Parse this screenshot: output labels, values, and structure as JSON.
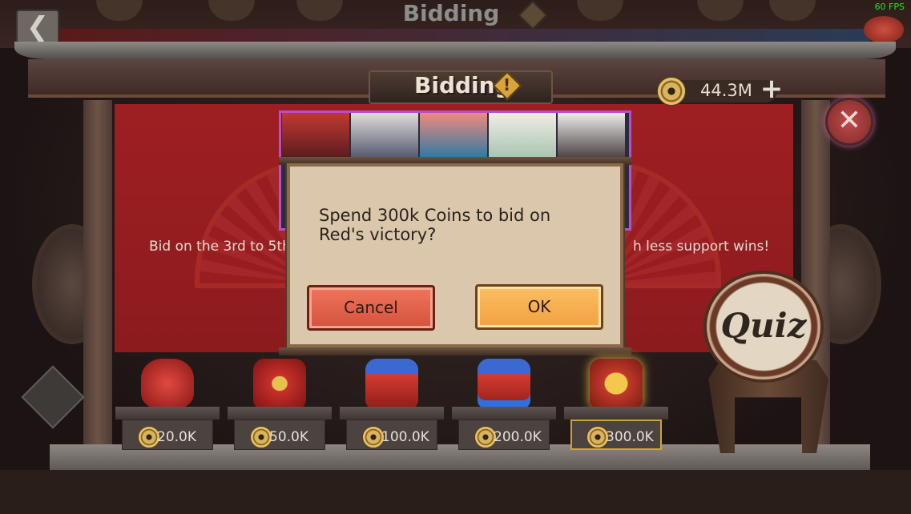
{
  "fps_counter": "60 FPS",
  "top_header": {
    "title": "Bidding"
  },
  "panel": {
    "title": "Bidding",
    "info_mark": "!",
    "currency_amount": "44.3M",
    "banner_text_left": "Bid on the 3rd to 5th",
    "banner_text_right": "h less support wins!"
  },
  "dialog": {
    "message": "Spend 300k Coins to bid on Red's victory?",
    "cancel_label": "Cancel",
    "ok_label": "OK"
  },
  "bid_tiers": [
    {
      "price": "20.0K",
      "selected": false
    },
    {
      "price": "50.0K",
      "selected": false
    },
    {
      "price": "100.0K",
      "selected": false
    },
    {
      "price": "200.0K",
      "selected": false
    },
    {
      "price": "300.0K",
      "selected": true
    }
  ],
  "quiz_button": {
    "label": "Quiz"
  },
  "icons": {
    "back": "back-arrow-icon",
    "close": "close-icon",
    "add": "plus-icon",
    "coin": "coin-icon",
    "info": "info-icon"
  },
  "colors": {
    "banner_red": "#9e1f22",
    "cancel_button": "#e4614a",
    "ok_button": "#f7b050",
    "dialog_bg": "#dbc7ab",
    "fps_green": "#1fe61f"
  }
}
